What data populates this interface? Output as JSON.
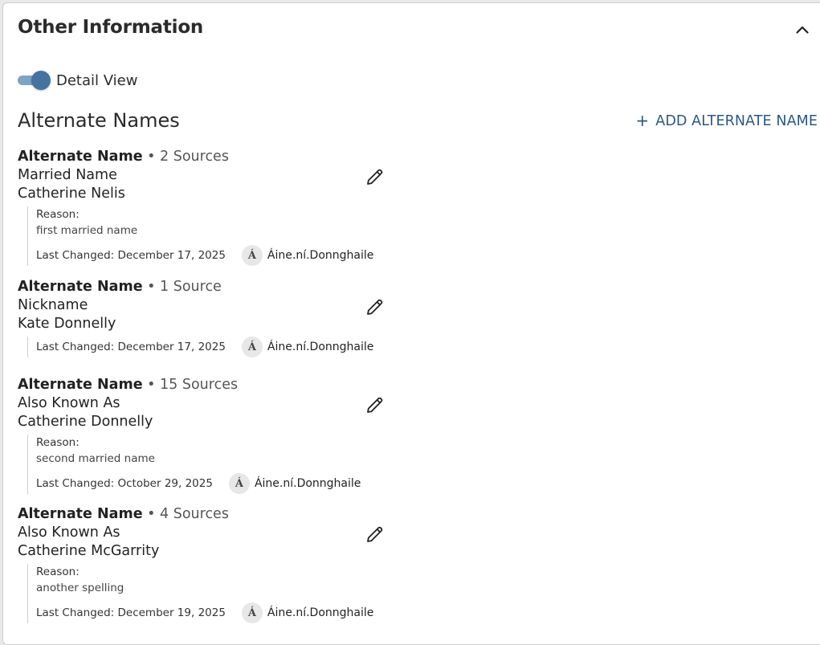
{
  "section": {
    "title": "Other Information",
    "collapse_icon": "chevron-up-icon"
  },
  "detail_view": {
    "label": "Detail View",
    "enabled": true,
    "accent": "#44739f"
  },
  "alternate_names": {
    "title": "Alternate Names",
    "add_label": "ADD ALTERNATE NAME",
    "add_icon": "+",
    "entries": [
      {
        "type": "Alternate Name",
        "sources": "• 2 Sources",
        "name_type": "Married Name",
        "name": "Catherine Nelis",
        "reason_label": "Reason:",
        "reason": "first married name",
        "last_changed": "Last Changed: December 17, 2025",
        "avatar_initial": "Á",
        "user": "Áine.ní.Donnghaile"
      },
      {
        "type": "Alternate Name",
        "sources": "• 1 Source",
        "name_type": "Nickname",
        "name": "Kate Donnelly",
        "last_changed": "Last Changed: December 17, 2025",
        "avatar_initial": "Á",
        "user": "Áine.ní.Donnghaile"
      },
      {
        "type": "Alternate Name",
        "sources": "• 15 Sources",
        "name_type": "Also Known As",
        "name": "Catherine Donnelly",
        "reason_label": "Reason:",
        "reason": "second married name",
        "last_changed": "Last Changed: October 29, 2025",
        "avatar_initial": "Á",
        "user": "Áine.ní.Donnghaile"
      },
      {
        "type": "Alternate Name",
        "sources": "• 4 Sources",
        "name_type": "Also Known As",
        "name": "Catherine McGarrity",
        "reason_label": "Reason:",
        "reason": "another spelling",
        "last_changed": "Last Changed: December 19, 2025",
        "avatar_initial": "Á",
        "user": "Áine.ní.Donnghaile"
      }
    ]
  }
}
